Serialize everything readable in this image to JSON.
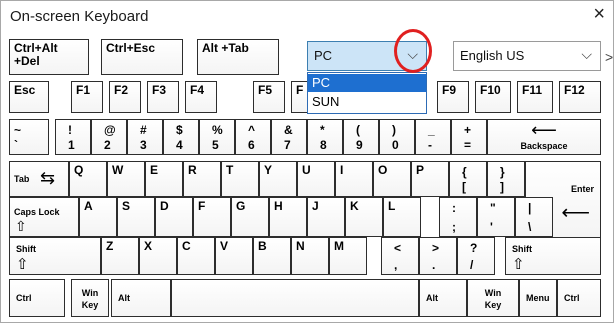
{
  "window": {
    "title": "On-screen Keyboard",
    "close_glyph": "×"
  },
  "top_row": {
    "ctrl_alt_del": "Ctrl+Alt\n+Del",
    "ctrl_esc": "Ctrl+Esc",
    "alt_tab": "Alt +Tab"
  },
  "layout_combo": {
    "value": "PC",
    "arrow": "⌵",
    "options": [
      "PC",
      "SUN"
    ]
  },
  "language_combo": {
    "value": "English US",
    "arrow": "⌵",
    "overflow": ">"
  },
  "keys": {
    "esc": "Esc",
    "f1": "F1",
    "f2": "F2",
    "f3": "F3",
    "f4": "F4",
    "f5": "F5",
    "f6": "F",
    "f9": "F9",
    "f10": "F10",
    "f11": "F11",
    "f12": "F12",
    "tilde_top": "~",
    "tilde_bot": "`",
    "k1_top": "!",
    "k1_bot": "1",
    "k2_top": "@",
    "k2_bot": "2",
    "k3_top": "#",
    "k3_bot": "3",
    "k4_top": "$",
    "k4_bot": "4",
    "k5_top": "%",
    "k5_bot": "5",
    "k6_top": "^",
    "k6_bot": "6",
    "k7_top": "&",
    "k7_bot": "7",
    "k8_top": "*",
    "k8_bot": "8",
    "k9_top": "(",
    "k9_bot": "9",
    "k0_top": ")",
    "k0_bot": "0",
    "minus_top": "_",
    "minus_bot": "-",
    "equal_top": "+",
    "equal_bot": "=",
    "backspace": "Backspace",
    "backspace_arrow": "⟵",
    "tab": "Tab",
    "tab_arrows": "⇆",
    "q": "Q",
    "w": "W",
    "e": "E",
    "r": "R",
    "t": "T",
    "y": "Y",
    "u": "U",
    "i": "I",
    "o": "O",
    "p": "P",
    "lbrace_top": "{",
    "lbrace_bot": "[",
    "rbrace_top": "}",
    "rbrace_bot": "]",
    "enter": "Enter",
    "enter_arrow": "⟵",
    "caps": "Caps Lock",
    "caps_arrow": "⇧",
    "a": "A",
    "s": "S",
    "d": "D",
    "f": "F",
    "g": "G",
    "h": "H",
    "j": "J",
    "k": "K",
    "l": "L",
    "colon_top": ":",
    "colon_bot": ";",
    "quote_top": "\"",
    "quote_bot": "'",
    "pipe_top": "|",
    "pipe_bot": "\\",
    "shift_left": "Shift",
    "shift_left_arrow": "⇧",
    "z": "Z",
    "x": "X",
    "c": "C",
    "v": "V",
    "b": "B",
    "n": "N",
    "m": "M",
    "lt_top": "<",
    "lt_bot": ",",
    "gt_top": ">",
    "gt_bot": ".",
    "qmark_top": "?",
    "qmark_bot": "/",
    "shift_right": "Shift",
    "shift_right_arrow": "⇧",
    "ctrl_left": "Ctrl",
    "win_left": "Win\nKey",
    "alt_left": "Alt",
    "alt_right": "Alt",
    "win_right": "Win\nKey",
    "menu": "Menu",
    "ctrl_right": "Ctrl"
  }
}
